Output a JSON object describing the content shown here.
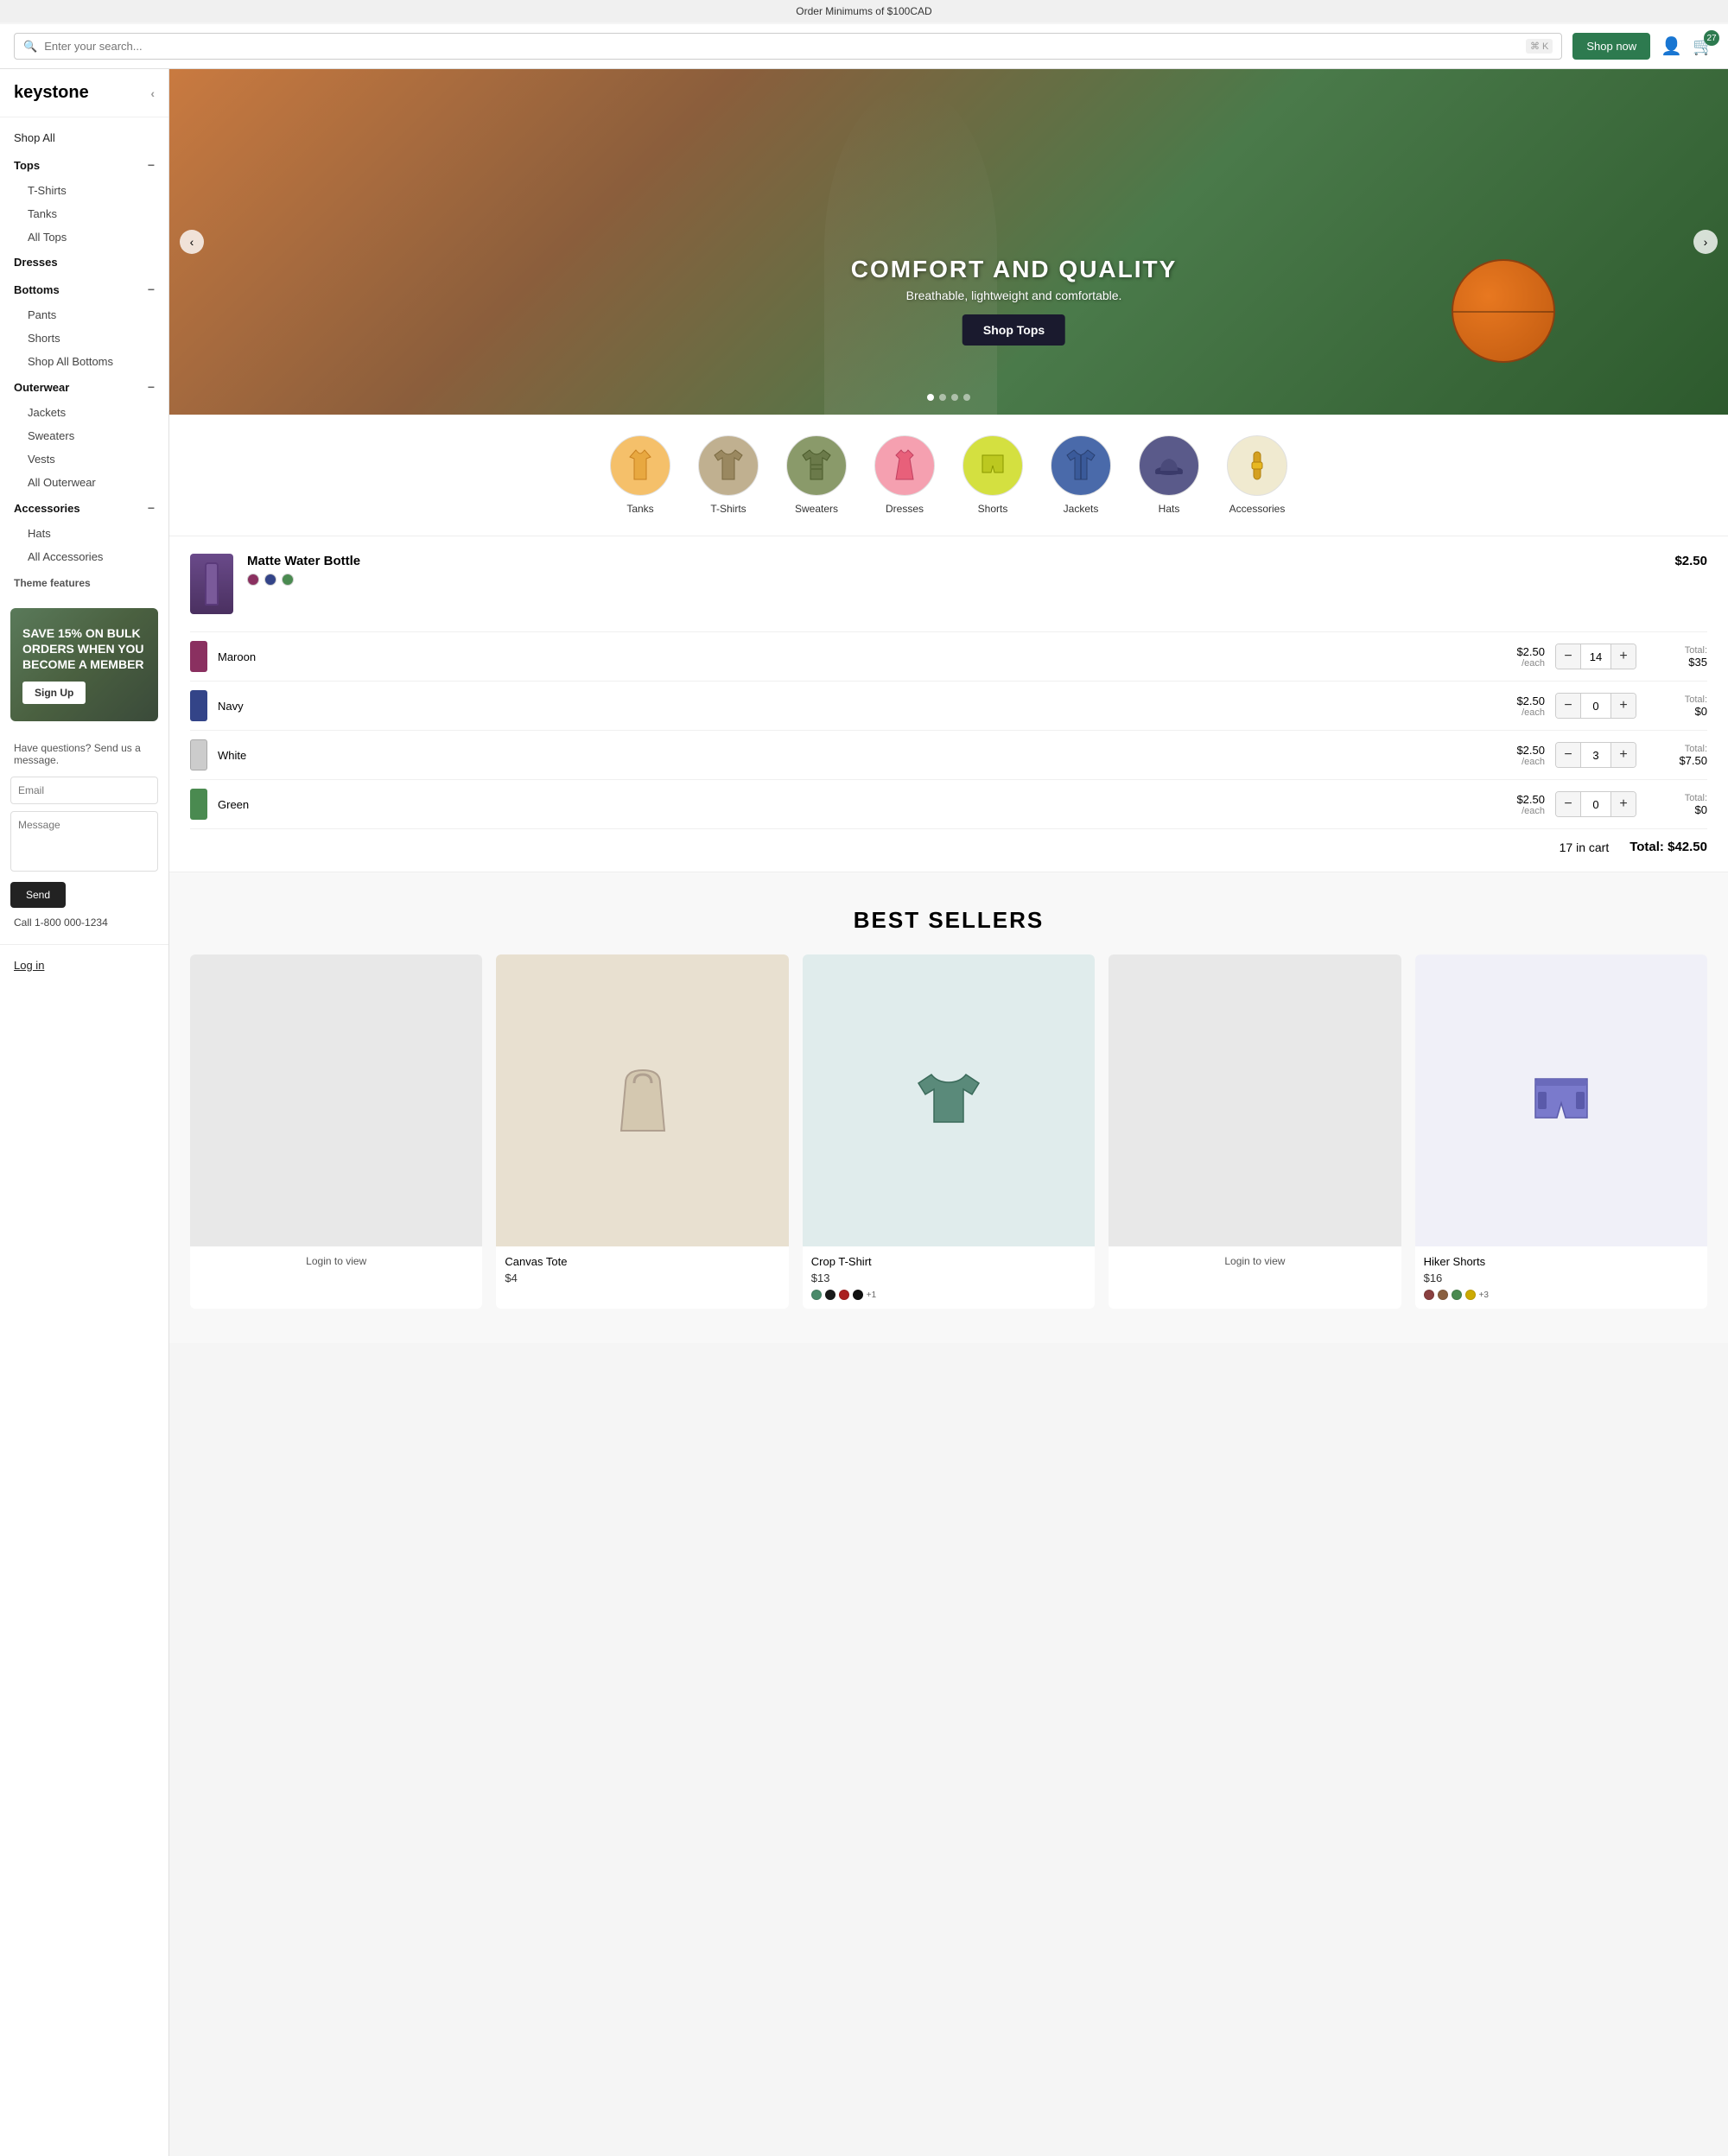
{
  "topbar": {
    "message": "Order Minimums of $100CAD"
  },
  "header": {
    "search_placeholder": "Enter your search...",
    "search_shortcut": "⌘ K",
    "shop_now": "Shop now",
    "cart_count": "27"
  },
  "sidebar": {
    "logo": "keystone",
    "shop_all": "Shop All",
    "sections": [
      {
        "title": "Tops",
        "expanded": true,
        "items": [
          "T-Shirts",
          "Tanks",
          "All Tops"
        ]
      },
      {
        "title": "Dresses",
        "expanded": false,
        "items": []
      },
      {
        "title": "Bottoms",
        "expanded": true,
        "items": [
          "Pants",
          "Shorts",
          "Shop All Bottoms"
        ]
      },
      {
        "title": "Outerwear",
        "expanded": true,
        "items": [
          "Jackets",
          "Sweaters",
          "Vests",
          "All Outerwear"
        ]
      },
      {
        "title": "Accessories",
        "expanded": true,
        "items": [
          "Hats",
          "All Accessories"
        ]
      }
    ],
    "theme_features": "Theme features",
    "promo_text": "SAVE 15% ON BULK ORDERS WHEN YOU BECOME A MEMBER",
    "signup_btn": "Sign Up",
    "contact_label": "Have questions? Send us a message.",
    "email_placeholder": "Email",
    "message_placeholder": "Message",
    "send_btn": "Send",
    "phone": "Call 1-800 000-1234",
    "login": "Log in"
  },
  "hero": {
    "title": "COMFORT AND QUALITY",
    "subtitle": "Breathable, lightweight and comfortable.",
    "shop_btn": "Shop Tops",
    "prev_arrow": "‹",
    "next_arrow": "›",
    "dots": [
      true,
      false,
      false,
      false
    ]
  },
  "categories": [
    {
      "label": "Tanks",
      "bg": "#f5c06a",
      "color": "#f5c06a"
    },
    {
      "label": "T-Shirts",
      "bg": "#c0b090",
      "color": "#c0b090"
    },
    {
      "label": "Sweaters",
      "bg": "#6b7a4a",
      "color": "#6b7a4a"
    },
    {
      "label": "Dresses",
      "bg": "#f5a0b0",
      "color": "#f5a0b0"
    },
    {
      "label": "Shorts",
      "bg": "#d4e040",
      "color": "#d4e040"
    },
    {
      "label": "Jackets",
      "bg": "#4a6aaa",
      "color": "#4a6aaa"
    },
    {
      "label": "Hats",
      "bg": "#3a3a6a",
      "color": "#3a3a6a"
    },
    {
      "label": "Accessories",
      "bg": "#f5f0e0",
      "color": "#e8c060"
    }
  ],
  "product": {
    "name": "Matte Water Bottle",
    "price": "$2.50",
    "colors": [
      "#8a3060",
      "#334488",
      "#aaaaaa",
      "#4a8a50"
    ],
    "variants": [
      {
        "name": "Maroon",
        "color": "#8a3060",
        "price": "$2.50",
        "per_each": "/each",
        "qty": 14,
        "total_label": "Total:",
        "total": "$35"
      },
      {
        "name": "Navy",
        "color": "#334488",
        "price": "$2.50",
        "per_each": "/each",
        "qty": 0,
        "total_label": "Total:",
        "total": "$0"
      },
      {
        "name": "White",
        "color": "#cccccc",
        "price": "$2.50",
        "per_each": "/each",
        "qty": 3,
        "total_label": "Total:",
        "total": "$7.50"
      },
      {
        "name": "Green",
        "color": "#4a8a50",
        "price": "$2.50",
        "per_each": "/each",
        "qty": 0,
        "total_label": "Total:",
        "total": "$0"
      }
    ],
    "cart_count": "17 in cart",
    "cart_total_label": "Total:",
    "cart_total": "$42.50"
  },
  "best_sellers": {
    "title": "BEST SELLERS",
    "products": [
      {
        "name": "Login to view",
        "price": "",
        "login_required": true,
        "bg": "#e8e8e8",
        "colors": []
      },
      {
        "name": "Canvas Tote",
        "price": "$4",
        "login_required": false,
        "bg": "#f0f0e8",
        "colors": []
      },
      {
        "name": "Crop T-Shirt",
        "price": "$13",
        "login_required": false,
        "bg": "#e0ecec",
        "colors": [
          "#4a8a6a",
          "#1a1a1a",
          "#aa2020",
          "#111111"
        ],
        "extra_colors": "+1"
      },
      {
        "name": "Login to view",
        "price": "",
        "login_required": true,
        "bg": "#e8e8e8",
        "colors": []
      },
      {
        "name": "Hiker Shorts",
        "price": "$16",
        "login_required": false,
        "bg": "#f0f0f0",
        "colors": [
          "#8a4040",
          "#8a6040",
          "#4a8a50",
          "#ccaa00"
        ],
        "extra_colors": "+3"
      }
    ]
  }
}
